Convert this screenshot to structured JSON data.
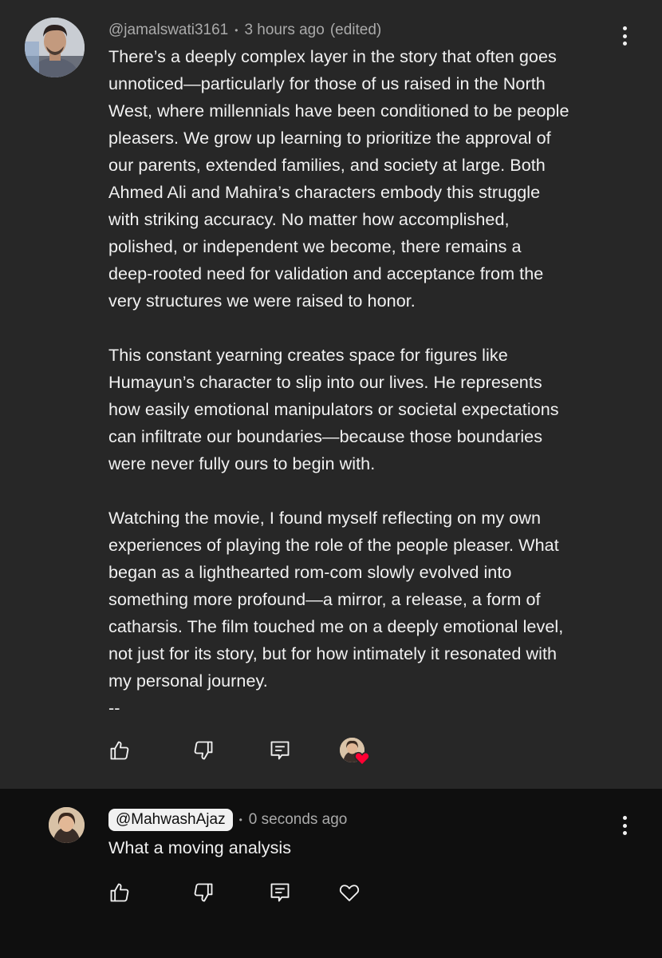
{
  "main_comment": {
    "author": "@jamalswati3161",
    "time": "3 hours ago",
    "edited": "(edited)",
    "text": "There’s a deeply complex layer in the story that often goes\nunnoticed—particularly for those of us raised in the North\nWest, where millennials have been conditioned to be people\npleasers. We grow up learning to prioritize the approval of\nour parents, extended families, and society at large. Both\nAhmed Ali and Mahira’s characters embody this struggle\nwith striking accuracy. No matter how accomplished,\npolished, or independent we become, there remains a\ndeep-rooted need for validation and acceptance from the\nvery structures we were raised to honor.\n\nThis constant yearning creates space for figures like\nHumayun’s character to slip into our lives. He represents\nhow easily emotional manipulators or societal expectations\ncan infiltrate our boundaries—because those boundaries\nwere never fully ours to begin with.\n\nWatching the movie, I found myself reflecting on my own\nexperiences of playing the role of the people pleaser. What\nbegan as a lighthearted rom-com slowly evolved into\nsomething more profound—a mirror, a release, a form of\ncatharsis. The film touched me on a deeply emotional level,\nnot just for its story, but for how intimately it resonated with\nmy personal journey.\n--",
    "icons": {
      "like": "thumbs-up-icon",
      "dislike": "thumbs-down-icon",
      "reply": "reply-icon",
      "creator_heart": "creator-heart-icon",
      "menu": "more-vert-icon"
    },
    "colors": {
      "background": "#272727",
      "heart": "#ff0033"
    }
  },
  "reply_comment": {
    "author": "@MahwashAjaz",
    "time": "0 seconds ago",
    "text": "What a moving analysis",
    "icons": {
      "like": "thumbs-up-icon",
      "dislike": "thumbs-down-icon",
      "reply": "reply-icon",
      "heart": "heart-outline-icon",
      "menu": "more-vert-icon"
    },
    "colors": {
      "background": "#0f0f0f",
      "chip": "#f1f1f1"
    }
  }
}
